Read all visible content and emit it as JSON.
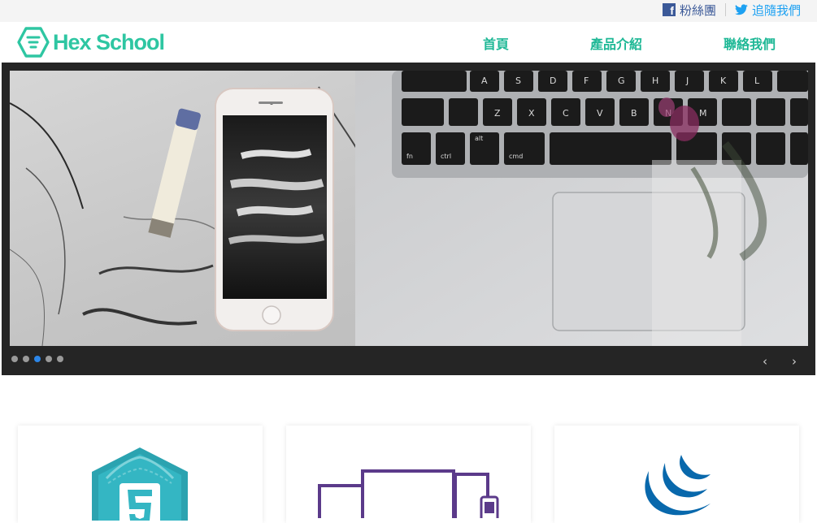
{
  "topbar": {
    "facebook_label": "粉絲團",
    "twitter_label": "追隨我們"
  },
  "header": {
    "logo_text": "Hex School",
    "nav": {
      "home": "首頁",
      "products": "產品介紹",
      "contact": "聯絡我們"
    }
  },
  "carousel": {
    "slide_count": 5,
    "active_index": 2,
    "prev_glyph": "‹",
    "next_glyph": "›",
    "key_labels": [
      "A",
      "S",
      "D",
      "F",
      "G",
      "H",
      "J",
      "K",
      "L",
      "Z",
      "X",
      "C",
      "V",
      "B",
      "N",
      "M",
      "fn",
      "ctrl",
      "cmd",
      "alt"
    ]
  },
  "cards": [
    {
      "icon": "html5-icon"
    },
    {
      "icon": "responsive-devices-icon"
    },
    {
      "icon": "jquery-icon"
    }
  ],
  "colors": {
    "brand": "#2ec6a2",
    "nav": "#1fb896",
    "facebook": "#3b5998",
    "twitter": "#1da1f2",
    "dot_active": "#2c86e8"
  }
}
